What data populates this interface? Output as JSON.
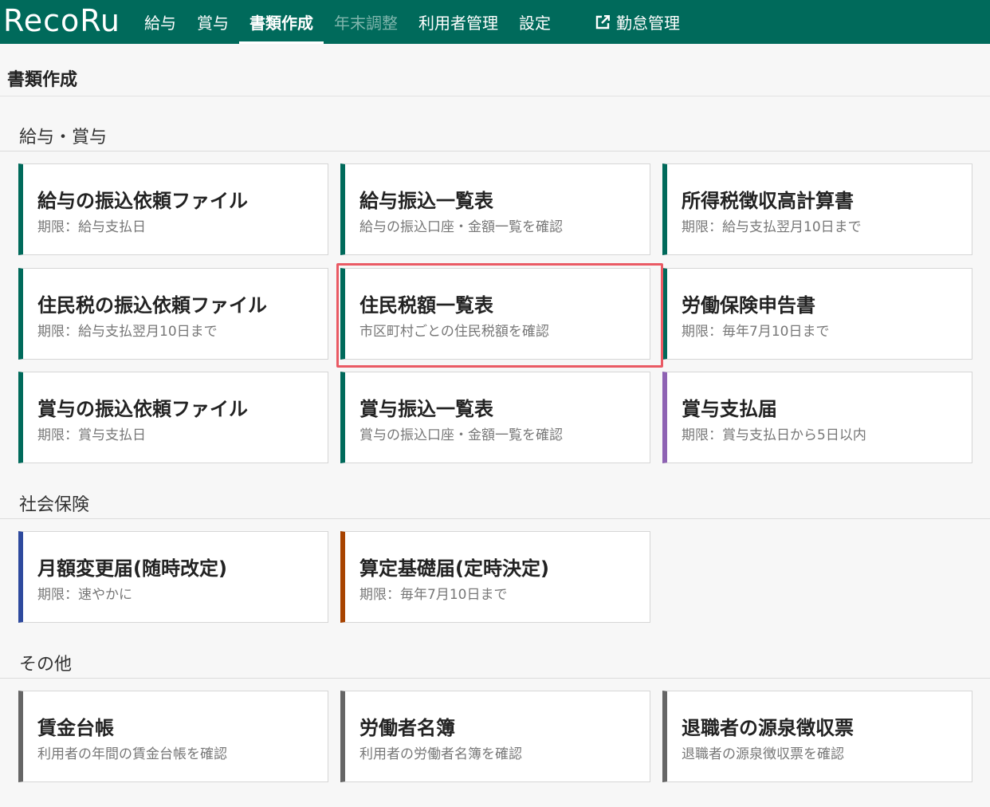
{
  "header": {
    "logo": "RecoRu",
    "nav": [
      {
        "label": "給与",
        "state": "normal"
      },
      {
        "label": "賞与",
        "state": "normal"
      },
      {
        "label": "書類作成",
        "state": "active"
      },
      {
        "label": "年末調整",
        "state": "disabled"
      },
      {
        "label": "利用者管理",
        "state": "normal"
      },
      {
        "label": "設定",
        "state": "normal"
      }
    ],
    "external_link": {
      "label": "勤怠管理",
      "icon": "external-link-icon"
    }
  },
  "page_title": "書類作成",
  "sections": [
    {
      "heading": "給与・賞与",
      "cards": [
        {
          "title": "給与の振込依頼ファイル",
          "subtitle": "期限：給与支払日",
          "accent": "#006a5b"
        },
        {
          "title": "給与振込一覧表",
          "subtitle": "給与の振込口座・金額一覧を確認",
          "accent": "#006a5b"
        },
        {
          "title": "所得税徴収高計算書",
          "subtitle": "期限：給与支払翌月10日まで",
          "accent": "#006a5b"
        },
        {
          "title": "住民税の振込依頼ファイル",
          "subtitle": "期限：給与支払翌月10日まで",
          "accent": "#006a5b"
        },
        {
          "title": "住民税額一覧表",
          "subtitle": "市区町村ごとの住民税額を確認",
          "accent": "#006a5b",
          "highlighted": true
        },
        {
          "title": "労働保険申告書",
          "subtitle": "期限：毎年7月10日まで",
          "accent": "#006a5b"
        },
        {
          "title": "賞与の振込依頼ファイル",
          "subtitle": "期限：賞与支払日",
          "accent": "#006a5b"
        },
        {
          "title": "賞与振込一覧表",
          "subtitle": "賞与の振込口座・金額一覧を確認",
          "accent": "#006a5b"
        },
        {
          "title": "賞与支払届",
          "subtitle": "期限：賞与支払日から5日以内",
          "accent": "#8e62b3"
        }
      ]
    },
    {
      "heading": "社会保険",
      "cards": [
        {
          "title": "月額変更届(随時改定)",
          "subtitle": "期限：速やかに",
          "accent": "#2e4a9e"
        },
        {
          "title": "算定基礎届(定時決定)",
          "subtitle": "期限：毎年7月10日まで",
          "accent": "#a84300"
        }
      ]
    },
    {
      "heading": "その他",
      "cards": [
        {
          "title": "賃金台帳",
          "subtitle": "利用者の年間の賃金台帳を確認",
          "accent": "#666666"
        },
        {
          "title": "労働者名簿",
          "subtitle": "利用者の労働者名簿を確認",
          "accent": "#666666"
        },
        {
          "title": "退職者の源泉徴収票",
          "subtitle": "退職者の源泉徴収票を確認",
          "accent": "#666666"
        }
      ]
    }
  ],
  "colors": {
    "header_bg": "#006a5b",
    "highlight_border": "#ea5a64"
  }
}
